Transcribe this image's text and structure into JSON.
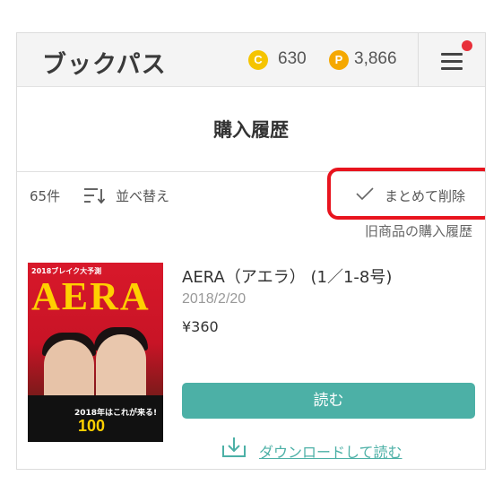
{
  "header": {
    "logo": "ブックパス",
    "coin_icon": "C",
    "coins": "630",
    "point_icon": "P",
    "points": "3,866",
    "menu_icon": "hamburger-menu-icon",
    "notification": "notification-dot"
  },
  "page": {
    "title": "購入履歴"
  },
  "toolbar": {
    "count": "65件",
    "sort_label": "並べ替え",
    "bulk_delete_label": "まとめて削除",
    "old_history_link": "旧商品の購入履歴"
  },
  "item": {
    "cover": {
      "masthead": "AERA",
      "top_text": "2018ブレイク大予測",
      "headline": "2018年はこれが来る!",
      "number": "100"
    },
    "title": "AERA（アエラ） (1／1-8号)",
    "date": "2018/2/20",
    "price": "¥360",
    "read_label": "読む",
    "download_label": "ダウンロードして読む"
  },
  "colors": {
    "accent": "#4cb0a6",
    "highlight": "#e8141e",
    "coin": "#f5c400",
    "point": "#f5a800"
  }
}
